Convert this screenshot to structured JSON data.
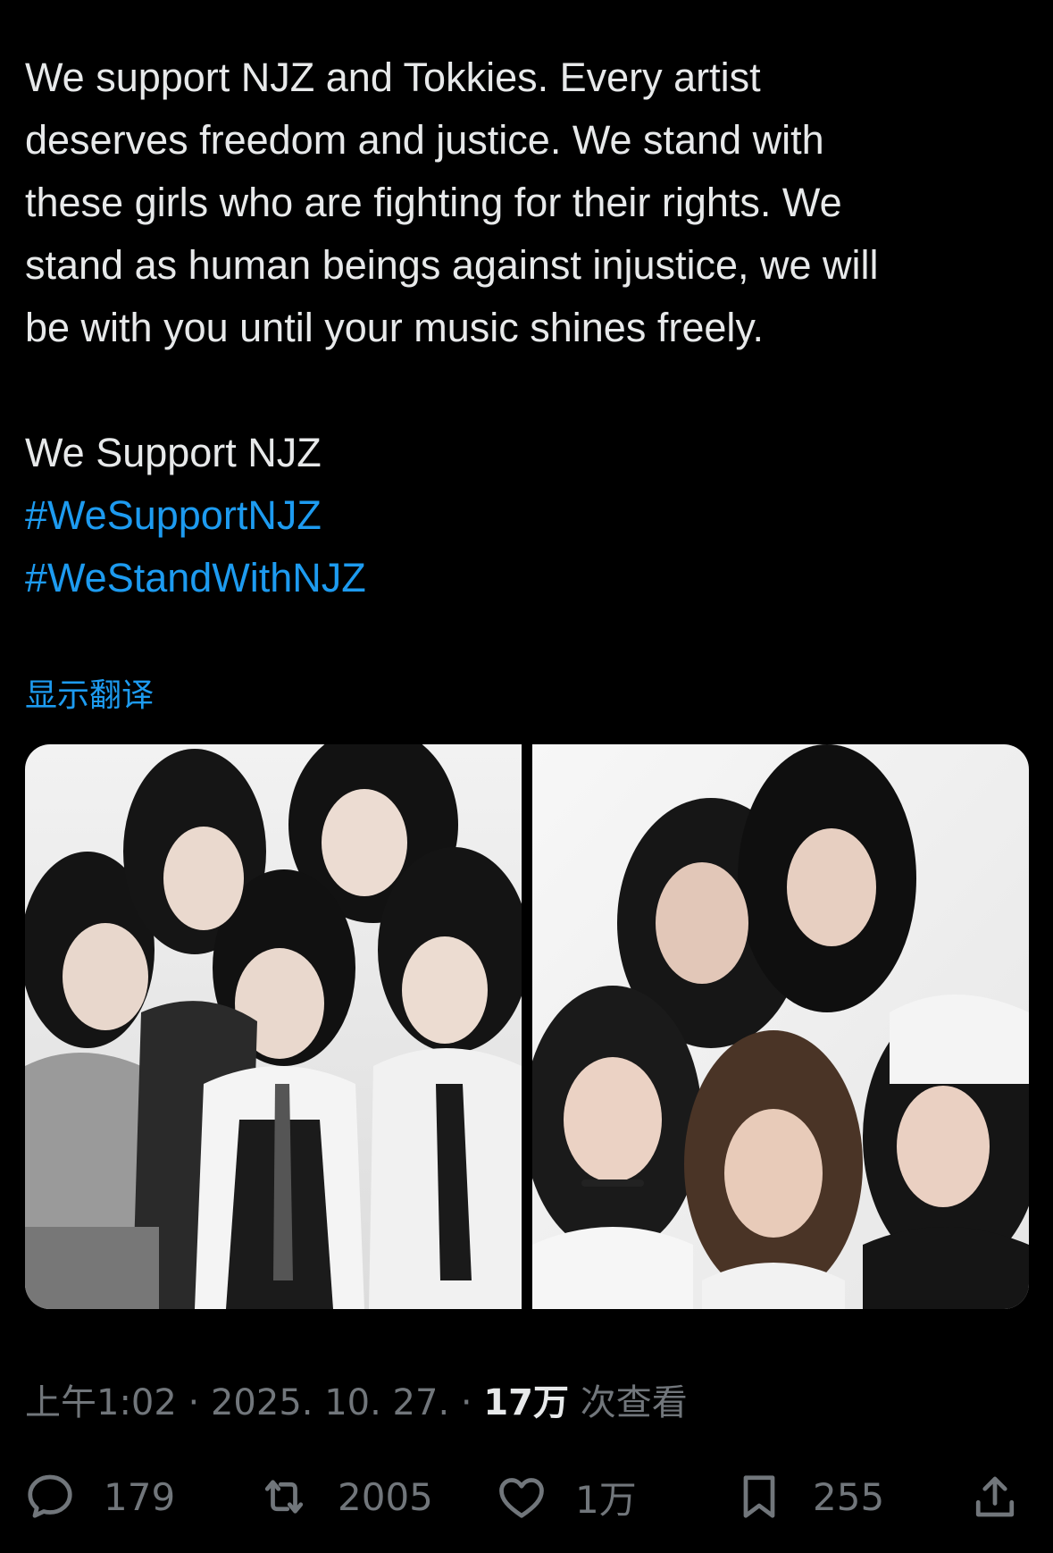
{
  "tweet": {
    "lines": [
      "We support NJZ and Tokkies. Every artist",
      "deserves freedom and justice. We stand with",
      "these girls who are fighting for their rights. We",
      "stand as human beings against injustice, we will",
      "be with you until your music shines freely."
    ],
    "closing": "We Support NJZ",
    "hashtags": [
      "#WeSupportNJZ",
      "#WeStandWithNJZ"
    ],
    "translate_label": "显示翻译"
  },
  "media": {
    "images": [
      {
        "icon": "group-photo-school-uniforms"
      },
      {
        "icon": "group-photo-black-white-outfits"
      }
    ]
  },
  "meta": {
    "time": "上午1:02",
    "separator": " · ",
    "date": "2025. 10. 27.",
    "views_count": "17万",
    "views_label": " 次查看"
  },
  "actions": {
    "reply": {
      "icon": "reply-icon",
      "count": "179"
    },
    "repost": {
      "icon": "repost-icon",
      "count": "2005"
    },
    "like": {
      "icon": "like-icon",
      "count": "1万"
    },
    "bookmark": {
      "icon": "bookmark-icon",
      "count": "255"
    },
    "share": {
      "icon": "share-icon"
    }
  },
  "colors": {
    "background": "#000000",
    "text": "#e7e9ea",
    "link": "#1d9bf0",
    "muted": "#71767b"
  }
}
